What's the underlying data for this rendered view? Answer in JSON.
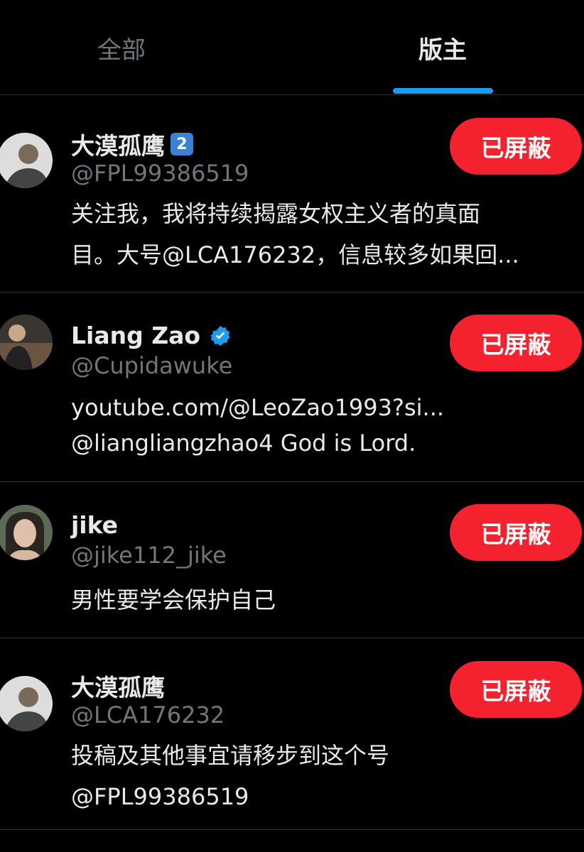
{
  "tabs": {
    "all_label": "全部",
    "moderator_label": "版主"
  },
  "colors": {
    "accent_blue": "#1d9bf0",
    "blocked_red": "#f4212e",
    "muted": "#71767b",
    "divider": "#2f3336"
  },
  "users": [
    {
      "name": "大漠孤鹰",
      "badge": "2",
      "handle": "@FPL99386519",
      "bio_lines": [
        "关注我，我将持续揭露女权主义者的真面",
        "目。大号@LCA176232，信息较多如果回..."
      ],
      "button_label": "已屏蔽",
      "avatar": "avatar-image"
    },
    {
      "name": "Liang Zao",
      "verified": true,
      "handle": "@Cupidawuke",
      "bio_lines": [
        "youtube.com/@LeoZao1993?si...",
        "@liangliangzhao4 God is Lord."
      ],
      "button_label": "已屏蔽",
      "avatar": "avatar-image"
    },
    {
      "name": "jike",
      "handle": "@jike112_jike",
      "bio_lines": [
        "男性要学会保护自己"
      ],
      "button_label": "已屏蔽",
      "avatar": "avatar-image"
    },
    {
      "name": "大漠孤鹰",
      "handle": "@LCA176232",
      "bio_lines": [
        "投稿及其他事宜请移步到这个号",
        "@FPL99386519"
      ],
      "button_label": "已屏蔽",
      "avatar": "avatar-image"
    }
  ]
}
